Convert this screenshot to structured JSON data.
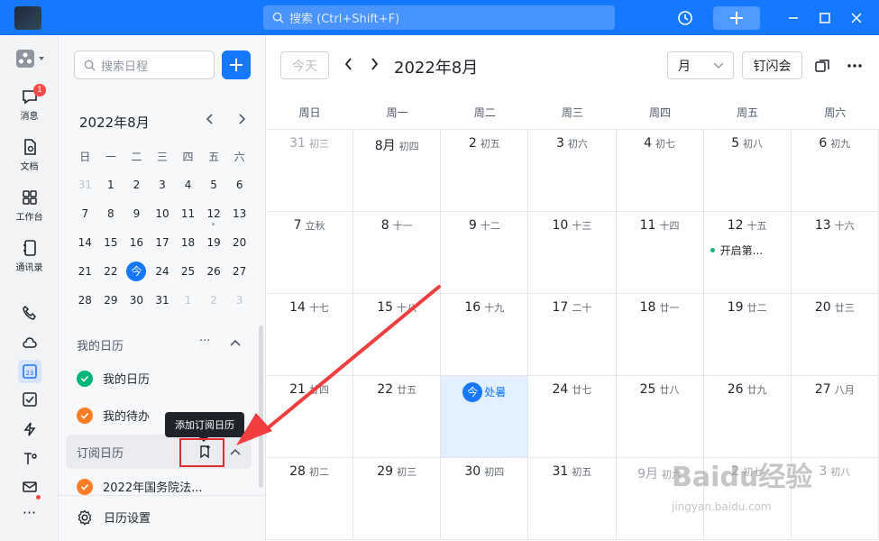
{
  "titlebar": {
    "search_placeholder": "搜索 (Ctrl+Shift+F)"
  },
  "nav": {
    "items": [
      {
        "label": "消息",
        "badge": "1"
      },
      {
        "label": "文档"
      },
      {
        "label": "工作台"
      },
      {
        "label": "通讯录"
      }
    ],
    "more": "···"
  },
  "panel": {
    "search_placeholder": "搜索日程",
    "mini_title": "2022年8月",
    "weekdays": [
      "日",
      "一",
      "二",
      "三",
      "四",
      "五",
      "六"
    ],
    "weeks": [
      [
        "31",
        "1",
        "2",
        "3",
        "4",
        "5",
        "6"
      ],
      [
        "7",
        "8",
        "9",
        "10",
        "11",
        "12",
        "13"
      ],
      [
        "14",
        "15",
        "16",
        "17",
        "18",
        "19",
        "20"
      ],
      [
        "21",
        "22",
        "今",
        "24",
        "25",
        "26",
        "27"
      ],
      [
        "28",
        "29",
        "30",
        "31",
        "1",
        "2",
        "3"
      ]
    ],
    "my_calendars_title": "我的日历",
    "my_calendars": [
      {
        "label": "我的日历",
        "color": "#00b578"
      },
      {
        "label": "我的待办",
        "color": "#ff7d26"
      }
    ],
    "subscribed_title": "订阅日历",
    "tooltip": "添加订阅日历",
    "subscribed": [
      {
        "label": "2022年国务院法...",
        "color": "#ff7d26"
      }
    ],
    "settings": "日历设置",
    "more_dots": "···"
  },
  "main": {
    "today_button": "今天",
    "month_title": "2022年8月",
    "view_select": "月",
    "dingshan_button": "钉闪会",
    "weekdays": [
      "周日",
      "周一",
      "周二",
      "周三",
      "周四",
      "周五",
      "周六"
    ],
    "weeks": [
      [
        {
          "n": "31",
          "l": "初三",
          "dim": true
        },
        {
          "n": "8月",
          "l": "初四"
        },
        {
          "n": "2",
          "l": "初五"
        },
        {
          "n": "3",
          "l": "初六"
        },
        {
          "n": "4",
          "l": "初七"
        },
        {
          "n": "5",
          "l": "初八"
        },
        {
          "n": "6",
          "l": "初九"
        }
      ],
      [
        {
          "n": "7",
          "l": "立秋"
        },
        {
          "n": "8",
          "l": "十一"
        },
        {
          "n": "9",
          "l": "十二"
        },
        {
          "n": "10",
          "l": "十三"
        },
        {
          "n": "11",
          "l": "十四"
        },
        {
          "n": "12",
          "l": "十五",
          "event": "开启第..."
        },
        {
          "n": "13",
          "l": "十六"
        }
      ],
      [
        {
          "n": "14",
          "l": "十七"
        },
        {
          "n": "15",
          "l": "十八"
        },
        {
          "n": "16",
          "l": "十九"
        },
        {
          "n": "17",
          "l": "二十"
        },
        {
          "n": "18",
          "l": "廿一"
        },
        {
          "n": "19",
          "l": "廿二"
        },
        {
          "n": "20",
          "l": "廿三"
        }
      ],
      [
        {
          "n": "21",
          "l": "廿四"
        },
        {
          "n": "22",
          "l": "廿五"
        },
        {
          "n": "今",
          "l": "处暑",
          "today": true
        },
        {
          "n": "24",
          "l": "廿七"
        },
        {
          "n": "25",
          "l": "廿八"
        },
        {
          "n": "26",
          "l": "廿九"
        },
        {
          "n": "27",
          "l": "八月"
        }
      ],
      [
        {
          "n": "28",
          "l": "初二"
        },
        {
          "n": "29",
          "l": "初三"
        },
        {
          "n": "30",
          "l": "初四"
        },
        {
          "n": "31",
          "l": "初五"
        },
        {
          "n": "9月",
          "l": "初六",
          "dim": true
        },
        {
          "n": "2",
          "l": "初七",
          "dim": true
        },
        {
          "n": "3",
          "l": "初八",
          "dim": true
        }
      ]
    ]
  },
  "watermark": {
    "text": "Baidu经验",
    "sub": "jingyan.baidu.com"
  },
  "colors": {
    "accent": "#1677ff",
    "highlight": "#e02f2f",
    "today_bg": "#e1efff"
  }
}
